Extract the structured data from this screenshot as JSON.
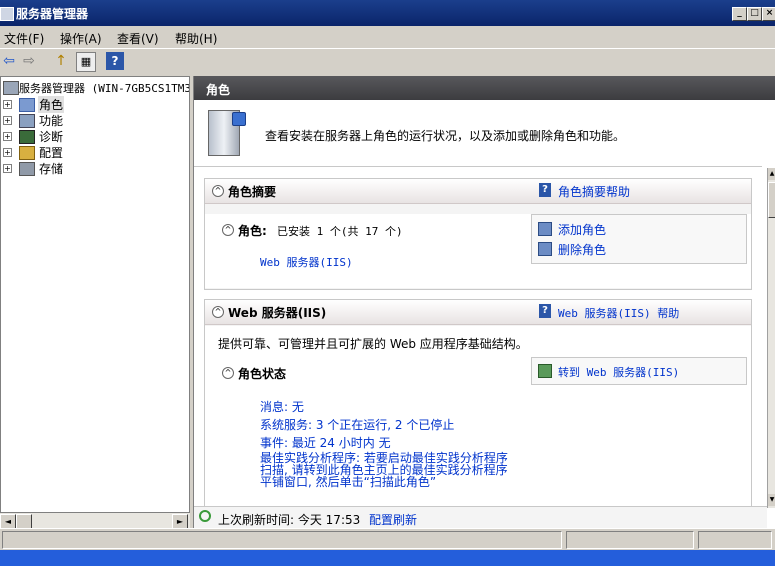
{
  "window": {
    "title": "服务器管理器",
    "minimize": "_",
    "maximize": "□",
    "close": "×"
  },
  "menu": [
    "文件(F)",
    "操作(A)",
    "查看(V)",
    "帮助(H)"
  ],
  "toolbar": {
    "back": "⇦",
    "forward": "⇨",
    "up": "↑",
    "view": "▦",
    "help": "?"
  },
  "tree": {
    "root": "服务器管理器 (WIN-7GB5CS1TM3",
    "items": [
      {
        "label": "角色",
        "selected": true
      },
      {
        "label": "功能"
      },
      {
        "label": "诊断"
      },
      {
        "label": "配置"
      },
      {
        "label": "存储"
      }
    ]
  },
  "hscroll": {
    "left": "◄",
    "right": "►"
  },
  "right": {
    "header": "角色",
    "intro": "查看安装在服务器上角色的运行状况，以及添加或删除角色和功能。",
    "summary": {
      "title": "角色摘要",
      "help": "角色摘要帮助",
      "roles_label": "角色:",
      "roles_value": "已安装 1 个(共 17 个)",
      "role_link": "Web 服务器(IIS)",
      "add": "添加角色",
      "remove": "删除角色"
    },
    "web": {
      "title": "Web 服务器(IIS)",
      "help": "Web 服务器(IIS) 帮助",
      "description": "提供可靠、可管理并且可扩展的 Web 应用程序基础结构。",
      "status_title": "角色状态",
      "goto": "转到 Web 服务器(IIS)",
      "messages": "消息: 无",
      "services": "系统服务: 3 个正在运行, 2 个已停止",
      "events": "事件: 最近 24 小时内 无",
      "bpa1": "最佳实践分析程序: 若要启动最佳实践分析程序",
      "bpa2": "扫描, 请转到此角色主页上的最佳实践分析程序",
      "bpa3": "平铺窗口, 然后单击“扫描此角色”"
    },
    "refresh": {
      "label": "上次刷新时间: 今天 17:53",
      "link": "配置刷新"
    }
  },
  "colors": {
    "titlebar": "#0a246a",
    "header": "#4a4a4d",
    "link": "#0033cc",
    "face": "#d4d0c8"
  }
}
